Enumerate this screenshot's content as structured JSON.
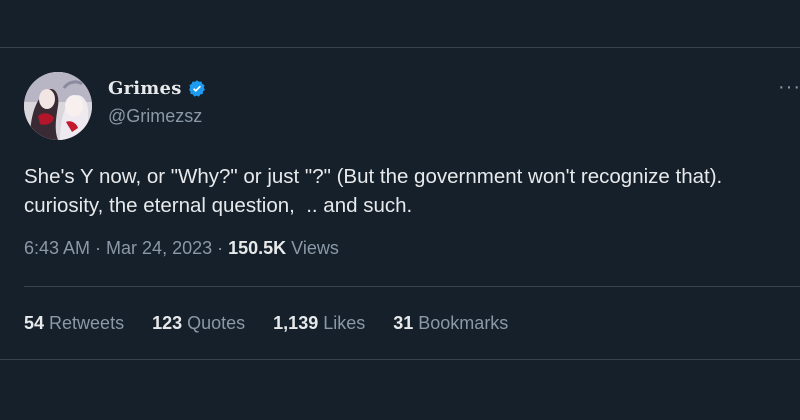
{
  "user": {
    "display_name": "Grimes",
    "handle": "@Grimezsz",
    "verified_icon": "verified-badge-icon",
    "accent_color": "#1d9bf0"
  },
  "more_icon": "ellipsis-icon",
  "tweet": {
    "text": "She's Y now, or \"Why?\" or just \"?\" (But the government won't recognize that).  curiosity, the eternal question,  .. and such.",
    "time": "6:43 AM",
    "separator": " · ",
    "date": "Mar 24, 2023",
    "views_count": "150.5K",
    "views_label": " Views"
  },
  "stats": {
    "retweets": {
      "count": "54",
      "label": " Retweets"
    },
    "quotes": {
      "count": "123",
      "label": " Quotes"
    },
    "likes": {
      "count": "1,139",
      "label": " Likes"
    },
    "bookmarks": {
      "count": "31",
      "label": " Bookmarks"
    }
  },
  "colors": {
    "background": "#15202b",
    "text": "#e7e9ea",
    "muted": "#8b98a5",
    "border": "#38444d"
  }
}
